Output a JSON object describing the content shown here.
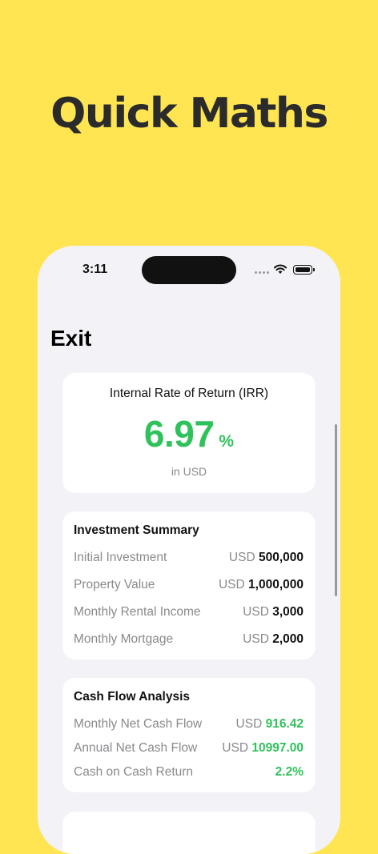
{
  "headline": "Quick Maths",
  "status_bar": {
    "time": "3:11"
  },
  "nav": {
    "exit_label": "Exit"
  },
  "irr": {
    "title": "Internal Rate of Return (IRR)",
    "value": "6.97",
    "unit": "%",
    "currency_note": "in USD"
  },
  "investment_summary": {
    "title": "Investment Summary",
    "rows": [
      {
        "label": "Initial Investment",
        "currency": "USD",
        "value": "500,000"
      },
      {
        "label": "Property Value",
        "currency": "USD",
        "value": "1,000,000"
      },
      {
        "label": "Monthly Rental Income",
        "currency": "USD",
        "value": "3,000"
      },
      {
        "label": "Monthly Mortgage",
        "currency": "USD",
        "value": "2,000"
      }
    ]
  },
  "cash_flow": {
    "title": "Cash Flow Analysis",
    "rows": [
      {
        "label": "Monthly Net Cash Flow",
        "currency": "USD",
        "value": "916.42"
      },
      {
        "label": "Annual Net Cash Flow",
        "currency": "USD",
        "value": "10997.00"
      },
      {
        "label": "Cash on Cash Return",
        "currency": "",
        "value": "2.2%"
      }
    ]
  },
  "colors": {
    "background": "#FFE552",
    "accent_green": "#2FC25B",
    "screen": "#F2F2F7"
  }
}
